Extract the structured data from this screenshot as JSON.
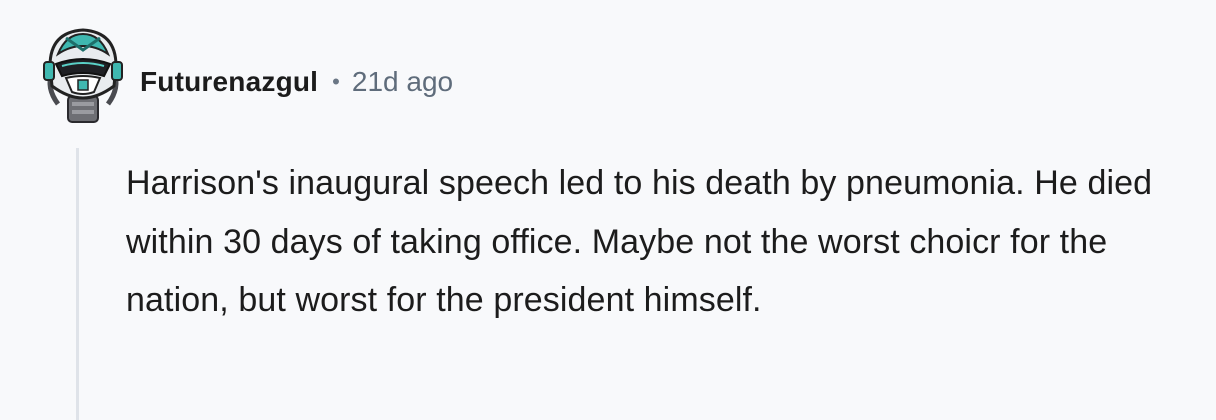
{
  "comment": {
    "author": "Futurenazgul",
    "separator": "•",
    "timestamp": "21d ago",
    "avatar_icon": "robot-avatar-icon",
    "body": "Harrison's inaugural speech led to his death by pneumonia. He died within 30 days of taking office. Maybe not the worst choicr for the nation, but worst for the president himself."
  },
  "colors": {
    "background": "#f8f9fb",
    "text": "#1c1c1c",
    "muted": "#5f6c7b",
    "thread_line": "#dfe3e9",
    "avatar_teal": "#3fb8b0"
  }
}
